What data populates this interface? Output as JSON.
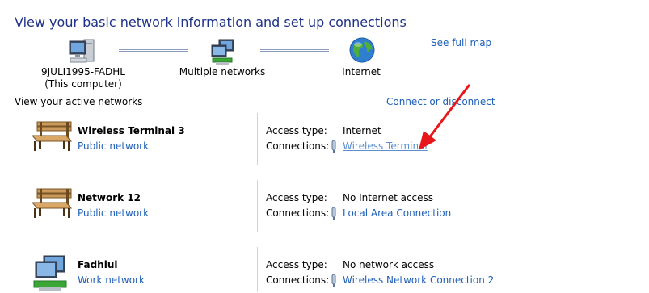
{
  "header": {
    "title": "View your basic network information and set up connections"
  },
  "network_map": {
    "see_full_map": "See full map",
    "computer": {
      "name": "9JULI1995-FADHL",
      "subtitle": "(This computer)"
    },
    "middle": {
      "label": "Multiple networks"
    },
    "internet": {
      "label": "Internet"
    }
  },
  "active_networks": {
    "section_label": "View your active networks",
    "connect_link": "Connect or disconnect",
    "access_type_label": "Access type:",
    "connections_label": "Connections:",
    "items": [
      {
        "name": "Wireless Terminal  3",
        "category": "Public network",
        "icon": "bench-icon",
        "access_type": "Internet",
        "connection": "Wireless Terminal"
      },
      {
        "name": "Network  12",
        "category": "Public network",
        "icon": "bench-icon",
        "access_type": "No Internet access",
        "connection": "Local Area Connection"
      },
      {
        "name": "Fadhlul",
        "category": "Work network",
        "icon": "work-network-icon",
        "access_type": "No network access",
        "connection": "Wireless Network Connection 2"
      }
    ]
  },
  "colors": {
    "title": "#1e3287",
    "link": "#1e5fb8",
    "arrow": "#e8161b",
    "rule": "#c9d4e3"
  }
}
